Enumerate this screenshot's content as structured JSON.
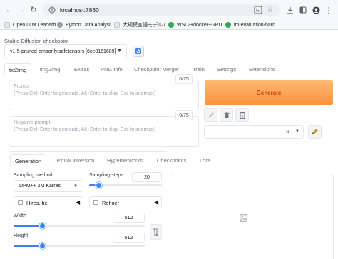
{
  "browser": {
    "url": "localhost:7860",
    "bookmarks": [
      {
        "label": "Open LLM Leaderb...",
        "color": "#e8eaed"
      },
      {
        "label": "Python Data Analysi...",
        "color": "#9aa0a6"
      },
      {
        "label": "大规模言語モデル (...",
        "color": "#e8eaed"
      },
      {
        "label": "WSL2+docker+GPU...",
        "color": "#34a853"
      },
      {
        "label": "lm-evaluation-harn...",
        "color": "#34a853"
      }
    ]
  },
  "checkpoint": {
    "label": "Stable Diffusion checkpoint",
    "value": "v1-5-pruned-emaonly.safetensors [6ce0161689]"
  },
  "tabs": [
    "txt2img",
    "img2img",
    "Extras",
    "PNG Info",
    "Checkpoint Merger",
    "Train",
    "Settings",
    "Extensions"
  ],
  "prompt": {
    "title": "Prompt",
    "placeholder": "(Press Ctrl+Enter to generate, Alt+Enter to skip, Esc to interrupt)",
    "token_count": "0/75"
  },
  "negative_prompt": {
    "title": "Negative prompt",
    "placeholder": "(Press Ctrl+Enter to generate, Alt+Enter to skip, Esc to interrupt)",
    "token_count": "0/75"
  },
  "generate_label": "Generate",
  "styles_clear": "×",
  "subtabs": [
    "Generation",
    "Textual Inversion",
    "Hypernetworks",
    "Checkpoints",
    "Lora"
  ],
  "generation": {
    "sampling_method_label": "Sampling method",
    "sampling_method_value": "DPM++ 2M Karras",
    "sampling_steps_label": "Sampling steps",
    "sampling_steps_value": "20",
    "sampling_steps_fraction": 0.13,
    "hires_fix_label": "Hires. fix",
    "refiner_label": "Refiner",
    "width_label": "Width",
    "width_value": "512",
    "width_fraction": 0.22,
    "height_label": "Height",
    "height_value": "512",
    "height_fraction": 0.22
  },
  "colors": {
    "accent": "#3b82f6",
    "generate_bg": "#fb923c",
    "generate_text": "#c2410c"
  }
}
